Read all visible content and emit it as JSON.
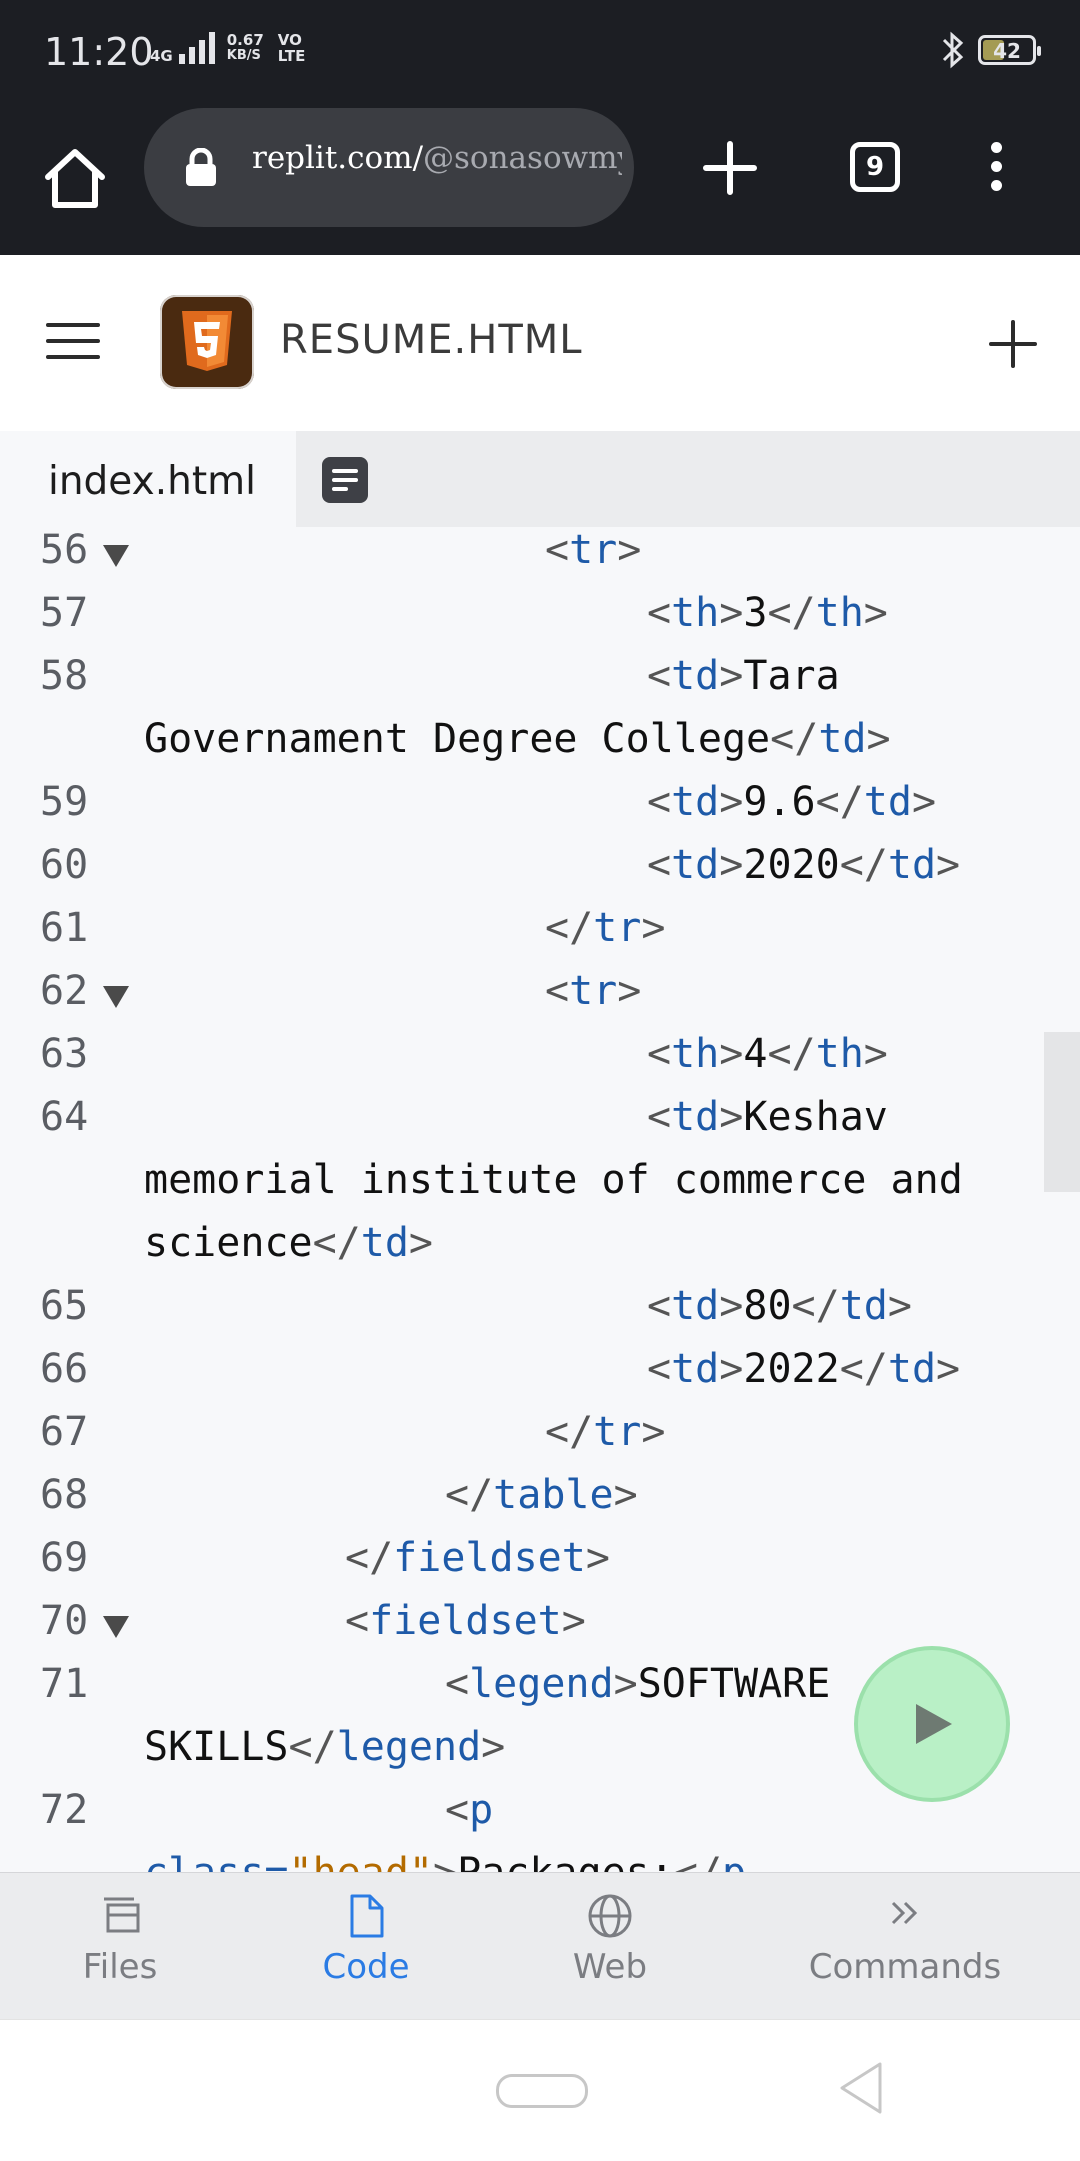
{
  "status_bar": {
    "time": "11:20",
    "network": "4G",
    "speed_value": "0.67",
    "speed_unit": "KB/S",
    "volte_top": "VO",
    "volte_bottom": "LTE",
    "battery": "42",
    "icons": [
      "bluetooth-icon",
      "battery-icon",
      "signal-icon"
    ]
  },
  "browser": {
    "url_main": "replit.com/",
    "url_path": "@sonasowmy",
    "tab_count": "9",
    "icons": [
      "home-icon",
      "lock-icon",
      "new-tab-plus-icon",
      "tabs-icon",
      "more-vert-icon"
    ]
  },
  "app_header": {
    "title": "RESUME.HTML",
    "icons": [
      "menu-icon",
      "html5-icon",
      "plus-icon"
    ]
  },
  "tabs": {
    "active": "index.html",
    "icons": [
      "console-icon"
    ]
  },
  "code": [
    {
      "n": "56",
      "fold": true,
      "cont": false,
      "parts": [
        {
          "t": "<",
          "c": "punc"
        },
        {
          "t": "tr",
          "c": "tag"
        },
        {
          "t": ">",
          "c": "punc"
        }
      ],
      "indent": 20
    },
    {
      "n": "57",
      "fold": false,
      "cont": false,
      "parts": [
        {
          "t": "<",
          "c": "punc"
        },
        {
          "t": "th",
          "c": "tag"
        },
        {
          "t": ">",
          "c": "punc"
        },
        {
          "t": "3",
          "c": "text"
        },
        {
          "t": "</",
          "c": "punc"
        },
        {
          "t": "th",
          "c": "tag"
        },
        {
          "t": ">",
          "c": "punc"
        }
      ],
      "indent": 24
    },
    {
      "n": "58",
      "fold": false,
      "cont": false,
      "parts": [
        {
          "t": "<",
          "c": "punc"
        },
        {
          "t": "td",
          "c": "tag"
        },
        {
          "t": ">",
          "c": "punc"
        },
        {
          "t": "Tara",
          "c": "text"
        }
      ],
      "indent": 24
    },
    {
      "n": "",
      "fold": false,
      "cont": true,
      "parts": [
        {
          "t": "Governament Degree College",
          "c": "text"
        },
        {
          "t": "</",
          "c": "punc"
        },
        {
          "t": "td",
          "c": "tag"
        },
        {
          "t": ">",
          "c": "punc"
        }
      ],
      "indent": 0
    },
    {
      "n": "59",
      "fold": false,
      "cont": false,
      "parts": [
        {
          "t": "<",
          "c": "punc"
        },
        {
          "t": "td",
          "c": "tag"
        },
        {
          "t": ">",
          "c": "punc"
        },
        {
          "t": "9.6",
          "c": "text"
        },
        {
          "t": "</",
          "c": "punc"
        },
        {
          "t": "td",
          "c": "tag"
        },
        {
          "t": ">",
          "c": "punc"
        }
      ],
      "indent": 24
    },
    {
      "n": "60",
      "fold": false,
      "cont": false,
      "parts": [
        {
          "t": "<",
          "c": "punc"
        },
        {
          "t": "td",
          "c": "tag"
        },
        {
          "t": ">",
          "c": "punc"
        },
        {
          "t": "2020",
          "c": "text"
        },
        {
          "t": "</",
          "c": "punc"
        },
        {
          "t": "td",
          "c": "tag"
        },
        {
          "t": ">",
          "c": "punc"
        }
      ],
      "indent": 24
    },
    {
      "n": "61",
      "fold": false,
      "cont": false,
      "parts": [
        {
          "t": "</",
          "c": "punc"
        },
        {
          "t": "tr",
          "c": "tag"
        },
        {
          "t": ">",
          "c": "punc"
        }
      ],
      "indent": 20
    },
    {
      "n": "62",
      "fold": true,
      "cont": false,
      "parts": [
        {
          "t": "<",
          "c": "punc"
        },
        {
          "t": "tr",
          "c": "tag"
        },
        {
          "t": ">",
          "c": "punc"
        }
      ],
      "indent": 20
    },
    {
      "n": "63",
      "fold": false,
      "cont": false,
      "parts": [
        {
          "t": "<",
          "c": "punc"
        },
        {
          "t": "th",
          "c": "tag"
        },
        {
          "t": ">",
          "c": "punc"
        },
        {
          "t": "4",
          "c": "text"
        },
        {
          "t": "</",
          "c": "punc"
        },
        {
          "t": "th",
          "c": "tag"
        },
        {
          "t": ">",
          "c": "punc"
        }
      ],
      "indent": 24
    },
    {
      "n": "64",
      "fold": false,
      "cont": false,
      "parts": [
        {
          "t": "<",
          "c": "punc"
        },
        {
          "t": "td",
          "c": "tag"
        },
        {
          "t": ">",
          "c": "punc"
        },
        {
          "t": "Keshav",
          "c": "text"
        }
      ],
      "indent": 24
    },
    {
      "n": "",
      "fold": false,
      "cont": true,
      "parts": [
        {
          "t": "memorial institute of commerce and",
          "c": "text"
        }
      ],
      "indent": 0
    },
    {
      "n": "",
      "fold": false,
      "cont": true,
      "parts": [
        {
          "t": "science",
          "c": "text"
        },
        {
          "t": "</",
          "c": "punc"
        },
        {
          "t": "td",
          "c": "tag"
        },
        {
          "t": ">",
          "c": "punc"
        }
      ],
      "indent": 0
    },
    {
      "n": "65",
      "fold": false,
      "cont": false,
      "parts": [
        {
          "t": "<",
          "c": "punc"
        },
        {
          "t": "td",
          "c": "tag"
        },
        {
          "t": ">",
          "c": "punc"
        },
        {
          "t": "80",
          "c": "text"
        },
        {
          "t": "</",
          "c": "punc"
        },
        {
          "t": "td",
          "c": "tag"
        },
        {
          "t": ">",
          "c": "punc"
        }
      ],
      "indent": 24
    },
    {
      "n": "66",
      "fold": false,
      "cont": false,
      "parts": [
        {
          "t": "<",
          "c": "punc"
        },
        {
          "t": "td",
          "c": "tag"
        },
        {
          "t": ">",
          "c": "punc"
        },
        {
          "t": "2022",
          "c": "text"
        },
        {
          "t": "</",
          "c": "punc"
        },
        {
          "t": "td",
          "c": "tag"
        },
        {
          "t": ">",
          "c": "punc"
        }
      ],
      "indent": 24
    },
    {
      "n": "67",
      "fold": false,
      "cont": false,
      "parts": [
        {
          "t": "</",
          "c": "punc"
        },
        {
          "t": "tr",
          "c": "tag"
        },
        {
          "t": ">",
          "c": "punc"
        }
      ],
      "indent": 20
    },
    {
      "n": "68",
      "fold": false,
      "cont": false,
      "parts": [
        {
          "t": "</",
          "c": "punc"
        },
        {
          "t": "table",
          "c": "tag"
        },
        {
          "t": ">",
          "c": "punc"
        }
      ],
      "indent": 16
    },
    {
      "n": "69",
      "fold": false,
      "cont": false,
      "parts": [
        {
          "t": "</",
          "c": "punc"
        },
        {
          "t": "fieldset",
          "c": "tag"
        },
        {
          "t": ">",
          "c": "punc"
        }
      ],
      "indent": 12
    },
    {
      "n": "70",
      "fold": true,
      "cont": false,
      "parts": [
        {
          "t": "<",
          "c": "punc"
        },
        {
          "t": "fieldset",
          "c": "tag"
        },
        {
          "t": ">",
          "c": "punc"
        }
      ],
      "indent": 12
    },
    {
      "n": "71",
      "fold": false,
      "cont": false,
      "parts": [
        {
          "t": "<",
          "c": "punc"
        },
        {
          "t": "legend",
          "c": "tag"
        },
        {
          "t": ">",
          "c": "punc"
        },
        {
          "t": "SOFTWARE",
          "c": "text"
        }
      ],
      "indent": 16
    },
    {
      "n": "",
      "fold": false,
      "cont": true,
      "parts": [
        {
          "t": "SKILLS",
          "c": "text"
        },
        {
          "t": "</",
          "c": "punc"
        },
        {
          "t": "legend",
          "c": "tag"
        },
        {
          "t": ">",
          "c": "punc"
        }
      ],
      "indent": 0
    },
    {
      "n": "72",
      "fold": false,
      "cont": false,
      "parts": [
        {
          "t": "<",
          "c": "punc"
        },
        {
          "t": "p",
          "c": "tag"
        }
      ],
      "indent": 16
    },
    {
      "n": "",
      "fold": false,
      "cont": true,
      "parts": [
        {
          "t": "class=",
          "c": "tag"
        },
        {
          "t": "\"head\"",
          "c": "str"
        },
        {
          "t": ">",
          "c": "punc"
        },
        {
          "t": "Packages:",
          "c": "text"
        },
        {
          "t": "</",
          "c": "punc"
        },
        {
          "t": "p",
          "c": "tag"
        }
      ],
      "indent": 0
    }
  ],
  "run_button": {
    "icon": "play-icon"
  },
  "bottom_nav": [
    {
      "label": "Files",
      "icon": "files-icon",
      "active": false
    },
    {
      "label": "Code",
      "icon": "file-icon",
      "active": true
    },
    {
      "label": "Web",
      "icon": "globe-icon",
      "active": false
    },
    {
      "label": "Commands",
      "icon": "chevron-double-right-icon",
      "active": false
    }
  ],
  "system_nav": {
    "icons": [
      "home-pill-icon",
      "back-icon"
    ]
  },
  "colors": {
    "tag": "#1e5aa8",
    "text": "#111111",
    "string": "#b36b00",
    "active_nav": "#2a7be4",
    "run_button": "#b9f0c6"
  }
}
